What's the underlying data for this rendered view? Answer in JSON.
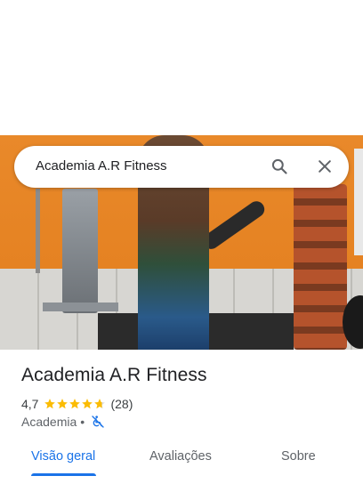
{
  "search": {
    "query": "Academia A.R Fitness"
  },
  "place": {
    "name": "Academia A.R Fitness",
    "rating": "4,7",
    "stars": 4.7,
    "review_count": "(28)",
    "category": "Academia",
    "separator": "•",
    "accessibility_icon": "not-wheelchair-accessible-icon"
  },
  "tabs": [
    {
      "label": "Visão geral",
      "active": true
    },
    {
      "label": "Avaliações",
      "active": false
    },
    {
      "label": "Sobre",
      "active": false
    }
  ],
  "colors": {
    "accent": "#1a73e8",
    "star": "#fbbc04",
    "text": "#202124"
  }
}
